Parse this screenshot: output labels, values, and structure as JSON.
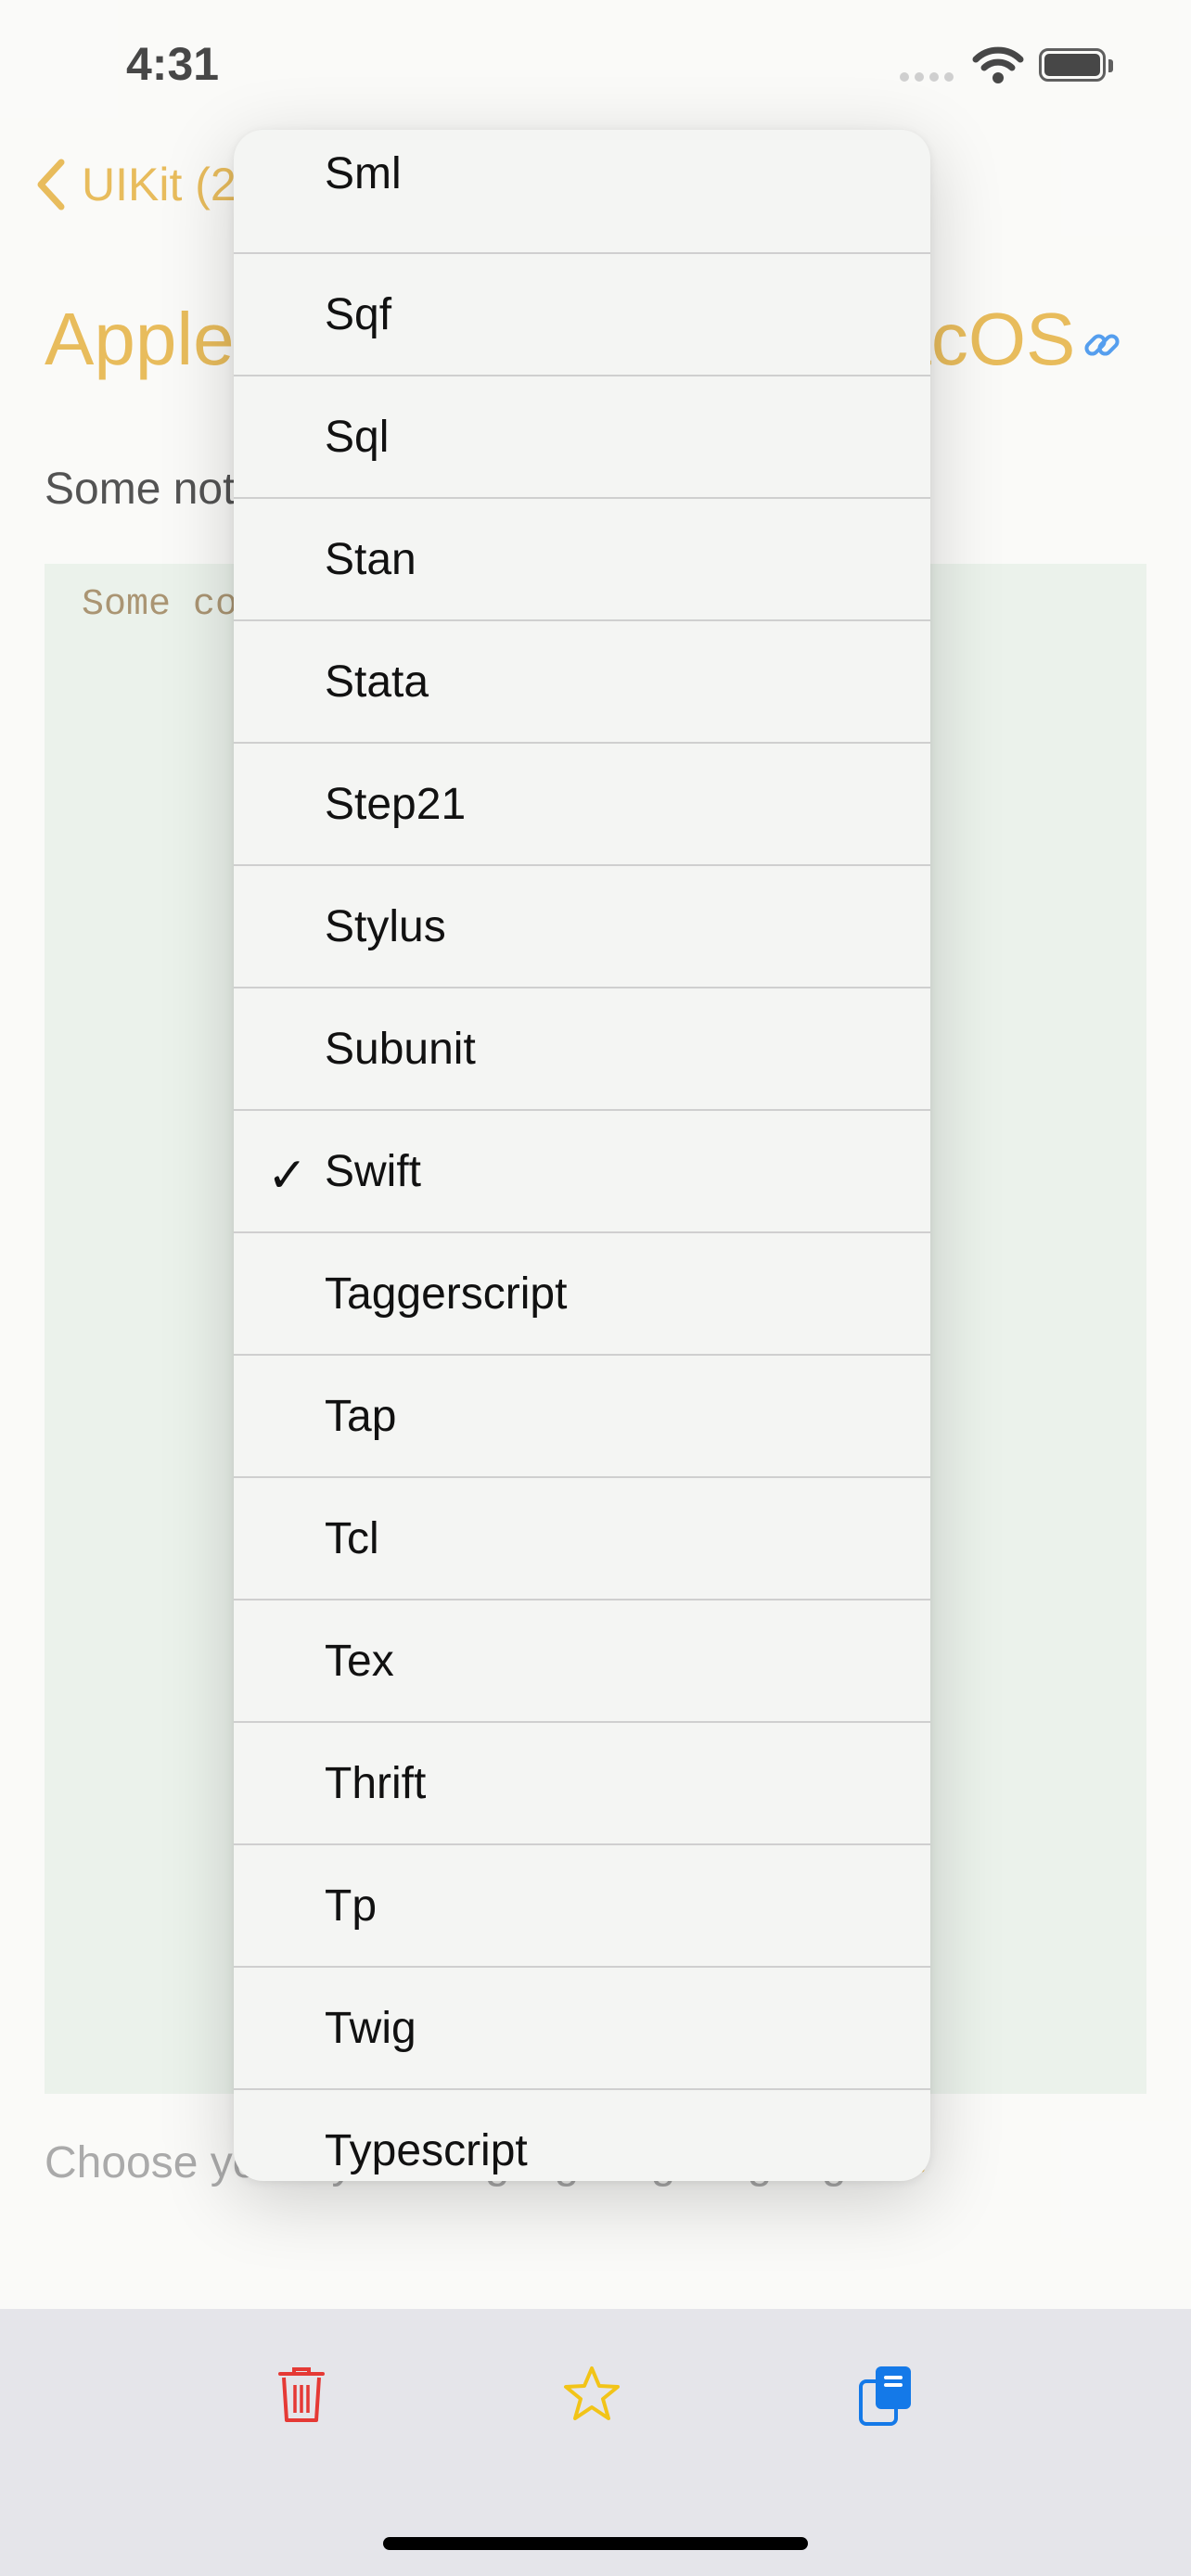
{
  "status_bar": {
    "time": "4:31"
  },
  "nav": {
    "back_label": "UIKit (2"
  },
  "page": {
    "title": "Apple UIKit Framework macOS",
    "notes": "Some notes",
    "code": "Some code",
    "chooser_text": "Choose your syntax highlighting language"
  },
  "language_menu": {
    "selected": "Swift",
    "items": [
      "Sml",
      "Sqf",
      "Sql",
      "Stan",
      "Stata",
      "Step21",
      "Stylus",
      "Subunit",
      "Swift",
      "Taggerscript",
      "Tap",
      "Tcl",
      "Tex",
      "Thrift",
      "Tp",
      "Twig",
      "Typescript"
    ],
    "check_mark": "✓"
  },
  "toolbar": {
    "delete_icon": "trash-icon",
    "favorite_icon": "star-icon",
    "copy_icon": "copy-icon"
  },
  "colors": {
    "accent": "#e0a21e",
    "delete": "#e53935",
    "favorite": "#f2c418",
    "copy": "#1479e8",
    "link": "#1479e8",
    "code_background": "#e3ede3"
  }
}
